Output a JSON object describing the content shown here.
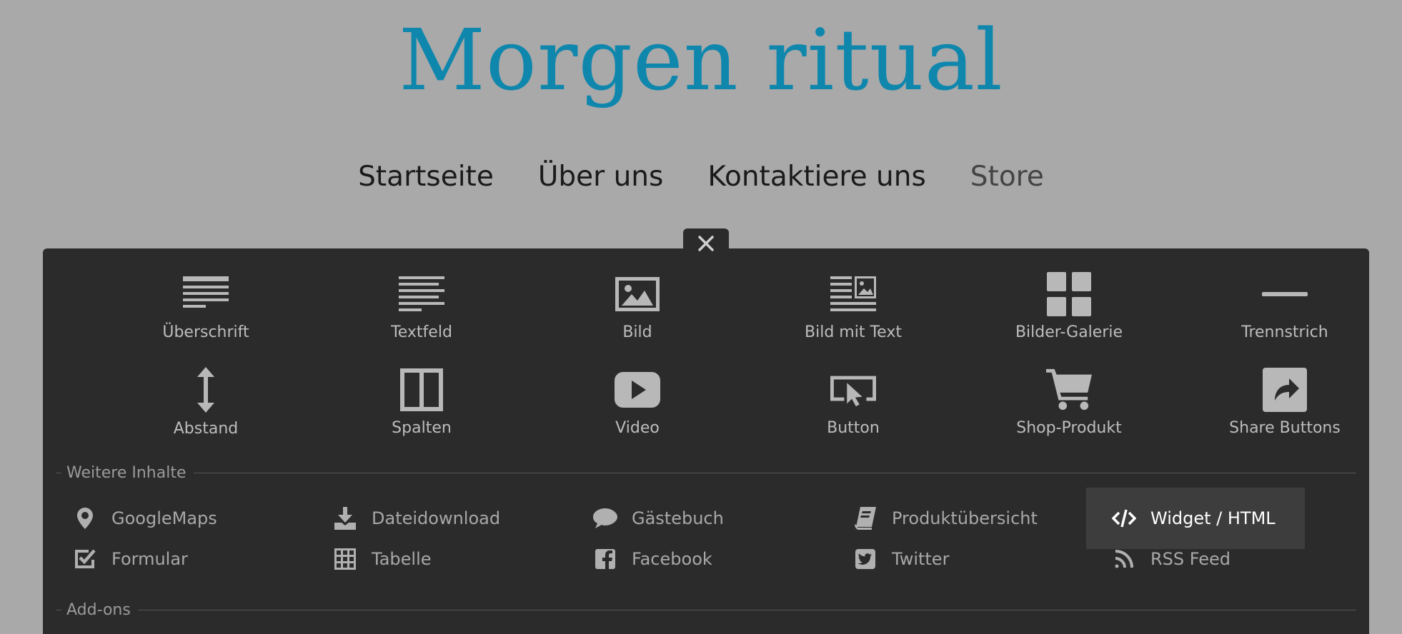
{
  "site": {
    "title": "Morgen ritual"
  },
  "nav": {
    "items": [
      "Startseite",
      "Über uns",
      "Kontaktiere uns",
      "Store"
    ]
  },
  "panel": {
    "close_icon": "close-icon",
    "elements": [
      {
        "label": "Überschrift",
        "icon": "heading-icon"
      },
      {
        "label": "Textfeld",
        "icon": "text-field-icon"
      },
      {
        "label": "Bild",
        "icon": "image-icon"
      },
      {
        "label": "Bild mit Text",
        "icon": "image-with-text-icon"
      },
      {
        "label": "Bilder-Galerie",
        "icon": "gallery-icon"
      },
      {
        "label": "Trennstrich",
        "icon": "divider-icon"
      },
      {
        "label": "Abstand",
        "icon": "spacing-icon"
      },
      {
        "label": "Spalten",
        "icon": "columns-icon"
      },
      {
        "label": "Video",
        "icon": "video-icon"
      },
      {
        "label": "Button",
        "icon": "button-icon"
      },
      {
        "label": "Shop-Produkt",
        "icon": "shopping-cart-icon"
      },
      {
        "label": "Share Buttons",
        "icon": "share-icon"
      }
    ],
    "more_heading": "Weitere Inhalte",
    "more": [
      {
        "label": "GoogleMaps",
        "icon": "map-pin-icon"
      },
      {
        "label": "Dateidownload",
        "icon": "download-icon"
      },
      {
        "label": "Gästebuch",
        "icon": "chat-bubble-icon"
      },
      {
        "label": "Produktübersicht",
        "icon": "book-icon"
      },
      {
        "label": "Widget / HTML",
        "icon": "code-icon",
        "active": true
      },
      {
        "label": "Formular",
        "icon": "checkbox-icon"
      },
      {
        "label": "Tabelle",
        "icon": "table-icon"
      },
      {
        "label": "Facebook",
        "icon": "facebook-icon"
      },
      {
        "label": "Twitter",
        "icon": "twitter-icon"
      },
      {
        "label": "RSS Feed",
        "icon": "rss-icon"
      }
    ],
    "addons_heading": "Add-ons"
  },
  "colors": {
    "page_bg": "#a9a9a9",
    "title": "#0f87ad",
    "panel_bg": "#2b2b2b",
    "active_item_bg": "#3d3d3d",
    "icon": "#b8b8b8"
  }
}
